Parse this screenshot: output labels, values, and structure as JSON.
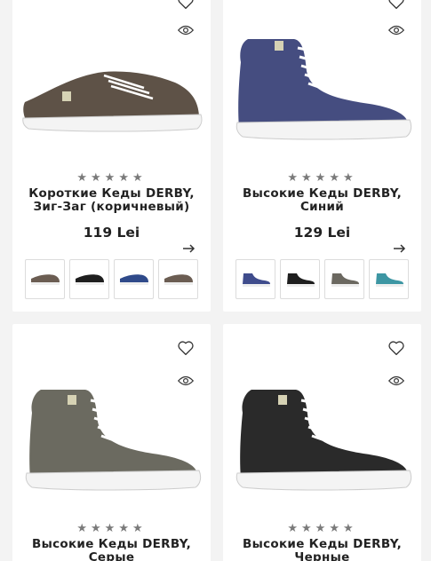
{
  "products": [
    {
      "title_line1": "Короткие Кеды DERBY,",
      "title_line2": "Зиг-Заг (коричневый)",
      "price": "119 Lei",
      "rating_stars": "★★★★★",
      "style": "low",
      "color": "#5e5247",
      "thumbs": [
        "#6b5d52",
        "#1e1e1e",
        "#2f4a8a",
        "#6b5d52"
      ]
    },
    {
      "title_line1": "Высокие Кеды DERBY,",
      "title_line2": "Синий",
      "price": "129 Lei",
      "rating_stars": "★★★★★",
      "style": "high",
      "color": "#454d80",
      "thumbs": [
        "#3f4c8c",
        "#1e1e1e",
        "#6b6860",
        "#3d96a3"
      ]
    },
    {
      "title_line1": "Высокие Кеды DERBY,",
      "title_line2": "Серые",
      "price": "",
      "rating_stars": "★★★★★",
      "style": "high",
      "color": "#6b6a60"
    },
    {
      "title_line1": "Высокие Кеды DERBY,",
      "title_line2": "Черные",
      "price": "",
      "rating_stars": "★★★★★",
      "style": "high",
      "color": "#2a2a2a"
    }
  ]
}
